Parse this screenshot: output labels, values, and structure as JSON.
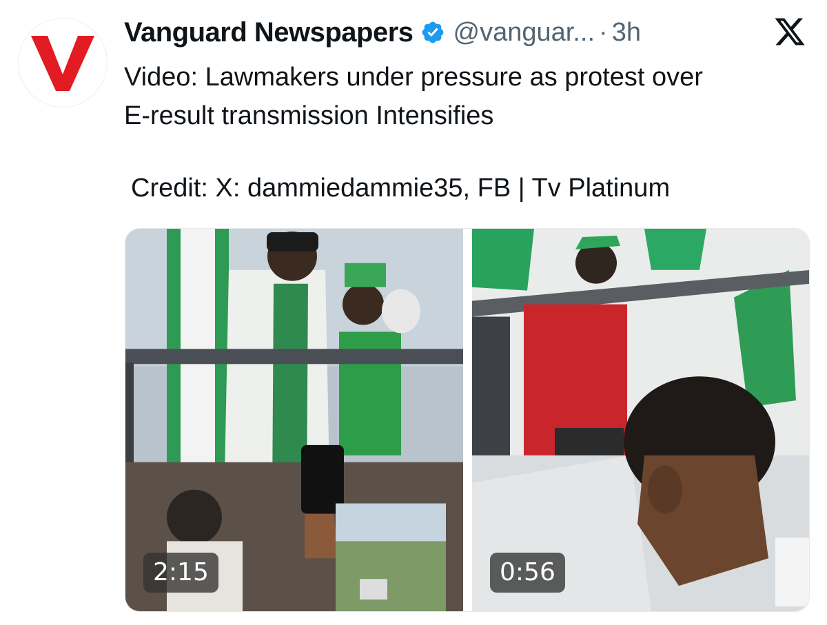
{
  "account": {
    "display_name": "Vanguard Newspapers",
    "handle": "@vanguar...",
    "separator": "·",
    "time_ago": "3h",
    "verified": true,
    "avatar_letter": "V",
    "avatar_color": "#e31b23",
    "verified_color": "#1d9bf0"
  },
  "tweet": {
    "lines": [
      "Video: Lawmakers under pressure as protest over",
      "E-result transmission Intensifies"
    ],
    "credit": "Credit: X:  dammiedammie35, FB | Tv Platinum"
  },
  "media": [
    {
      "kind": "video",
      "duration": "2:15"
    },
    {
      "kind": "video",
      "duration": "0:56"
    }
  ],
  "icons": {
    "avatar": "vanguard-logo-icon",
    "verified": "verified-badge-icon",
    "platform": "x-logo-icon"
  }
}
